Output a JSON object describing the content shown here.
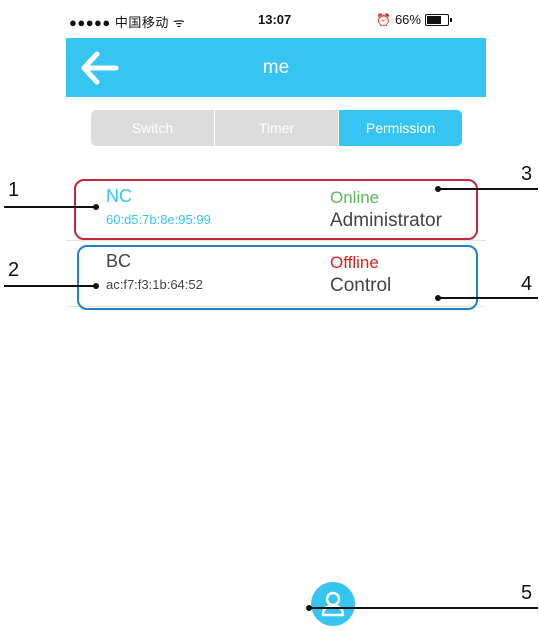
{
  "status_bar": {
    "carrier": "●●●●● 中国移动 ᯤ",
    "time": "13:07",
    "alarm": "⏰",
    "battery_text": "66%"
  },
  "nav": {
    "title": "me",
    "back_icon": "arrow-left-icon"
  },
  "tabs": [
    {
      "label": "Switch",
      "active": false
    },
    {
      "label": "Timer",
      "active": false
    },
    {
      "label": "Permission",
      "active": true
    }
  ],
  "devices": [
    {
      "name": "NC",
      "mac": "60:d5:7b:8e:95:99",
      "status": "Online",
      "role": "Administrator",
      "name_color": "#36c4f1",
      "status_color": "#5cb85c"
    },
    {
      "name": "BC",
      "mac": "ac:f7:f3:1b:64:52",
      "status": "Offline",
      "role": "Control",
      "name_color": "#444444",
      "status_color": "#e02020"
    }
  ],
  "callouts": [
    "1",
    "2",
    "3",
    "4",
    "5"
  ],
  "fab": {
    "icon": "user-icon"
  },
  "colors": {
    "accent": "#36c4f1",
    "segment_inactive": "#dcdcdc",
    "frame_red": "#c0283a",
    "frame_blue": "#1d82c8"
  }
}
